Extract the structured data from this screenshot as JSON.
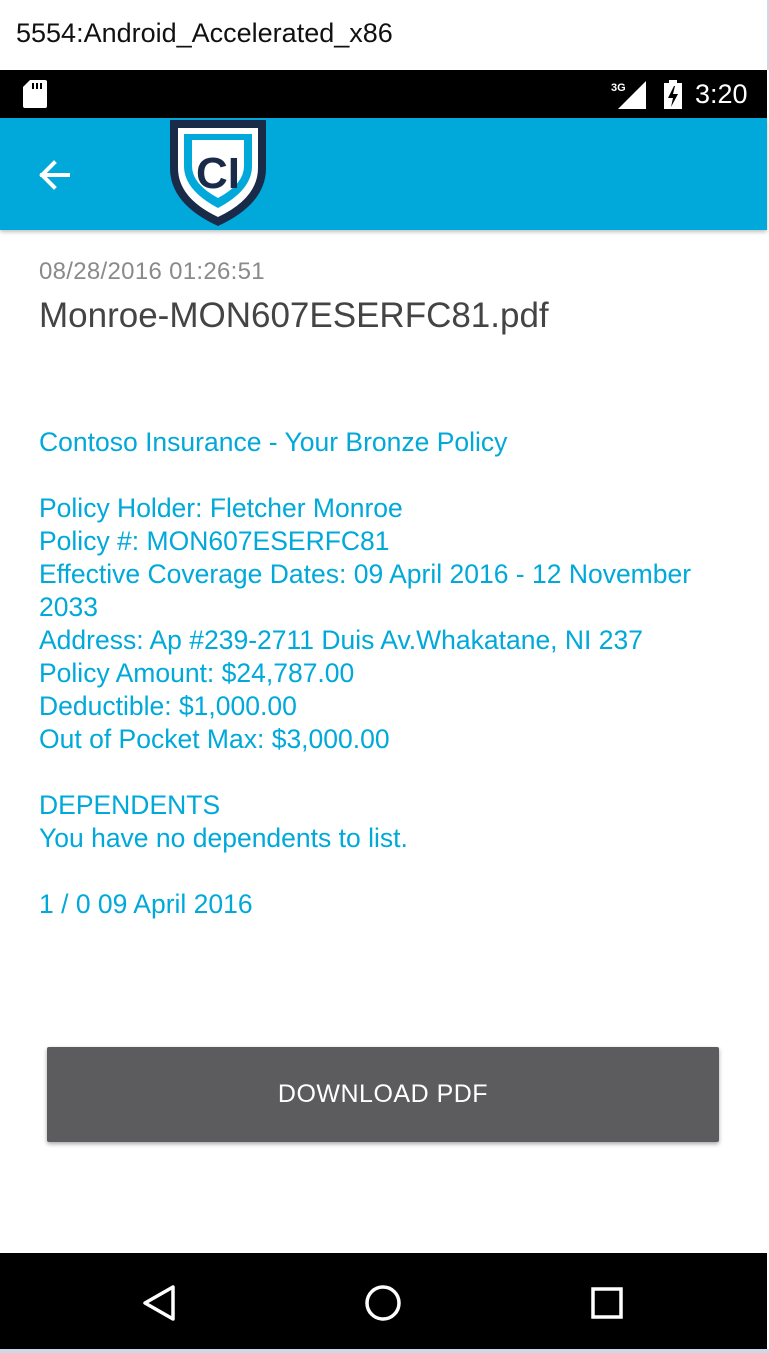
{
  "window": {
    "title": "5554:Android_Accelerated_x86"
  },
  "status_bar": {
    "time": "3:20",
    "network": "3G",
    "icons": [
      "sd-card-icon",
      "signal-icon",
      "battery-icon"
    ]
  },
  "app_bar": {
    "back_icon": "arrow-left-icon",
    "logo_text": "CI",
    "color": "#00a9d9"
  },
  "document": {
    "timestamp": "08/28/2016 01:26:51",
    "filename": "Monroe-MON607ESERFC81.pdf",
    "heading": "Contoso Insurance - Your Bronze Policy",
    "policy_holder": "Policy Holder: Fletcher Monroe",
    "policy_number": "Policy #: MON607ESERFC81",
    "coverage_dates": "Effective Coverage Dates: 09 April 2016 - 12 November 2033",
    "address": "Address: Ap #239-2711 Duis Av.Whakatane, NI 237",
    "policy_amount": "Policy Amount: $24,787.00",
    "deductible": "Deductible: $1,000.00",
    "out_of_pocket": "Out of Pocket Max: $3,000.00",
    "dependents_heading": "DEPENDENTS",
    "dependents_text": "You have no dependents to list.",
    "footer_line": "1 / 0 09 April 2016"
  },
  "download_button": {
    "label": "DOWNLOAD PDF"
  },
  "nav_bar": {
    "icons": [
      "back-triangle-icon",
      "home-circle-icon",
      "recents-square-icon"
    ]
  },
  "colors": {
    "accent": "#00a9d9",
    "button": "#5c5c5e",
    "logo_navy": "#1a2b4a"
  }
}
